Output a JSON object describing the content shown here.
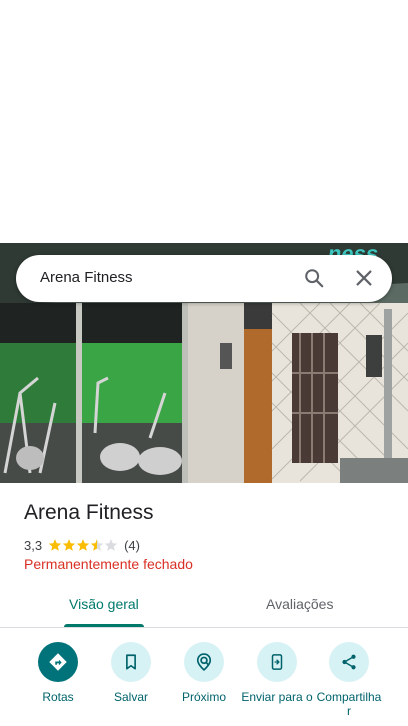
{
  "search": {
    "query": "Arena Fitness"
  },
  "place": {
    "name": "Arena Fitness",
    "rating": "3,3",
    "rating_stars": 3.3,
    "review_count": "(4)",
    "status": "Permanentemente fechado"
  },
  "tabs": [
    {
      "label": "Visão geral",
      "active": true
    },
    {
      "label": "Avaliações",
      "active": false
    }
  ],
  "actions": [
    {
      "label": "Rotas",
      "icon": "directions-icon"
    },
    {
      "label": "Salvar",
      "icon": "bookmark-icon"
    },
    {
      "label": "Próximo",
      "icon": "nearby-icon"
    },
    {
      "label": "Enviar para o",
      "icon": "send-to-phone-icon"
    },
    {
      "label": "Compartilha r",
      "icon": "share-icon"
    }
  ],
  "colors": {
    "accent": "#00796b",
    "action_bg": "#d7f2f4",
    "primary_action_bg": "#00737a",
    "closed_red": "#d93025",
    "star_gold": "#fbbc04"
  }
}
